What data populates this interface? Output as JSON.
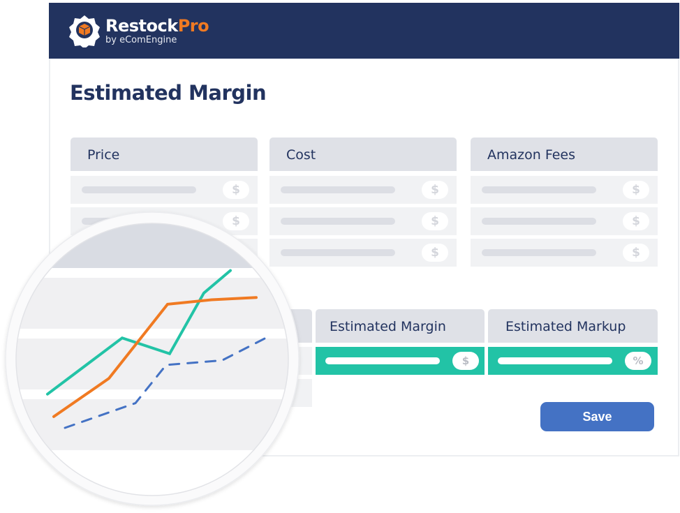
{
  "header": {
    "logo_main": "Restock",
    "logo_accent": "Pro",
    "logo_sub": "by eComEngine"
  },
  "page_title": "Estimated Margin",
  "inputs": [
    {
      "label": "Price",
      "unit": "$"
    },
    {
      "label": "Cost",
      "unit": "$"
    },
    {
      "label": "Amazon Fees",
      "unit": "$"
    }
  ],
  "results": [
    {
      "label": "Estimated Margin",
      "unit": "$"
    },
    {
      "label": "Estimated Markup",
      "unit": "%"
    }
  ],
  "save_label": "Save",
  "colors": {
    "navy": "#22335f",
    "teal": "#22c3a6",
    "orange": "#f07a22",
    "blue": "#4472c4"
  },
  "chart_data": {
    "type": "line",
    "x": [
      1,
      2,
      3,
      4,
      5
    ],
    "series": [
      {
        "color": "#22c3a6",
        "style": "solid",
        "values": [
          20,
          45,
          38,
          65,
          75
        ]
      },
      {
        "color": "#f07a22",
        "style": "solid",
        "values": [
          10,
          27,
          60,
          62,
          63
        ]
      },
      {
        "color": "#4472c4",
        "style": "dashed",
        "values": [
          5,
          16,
          33,
          35,
          46
        ]
      }
    ],
    "grid": false
  }
}
